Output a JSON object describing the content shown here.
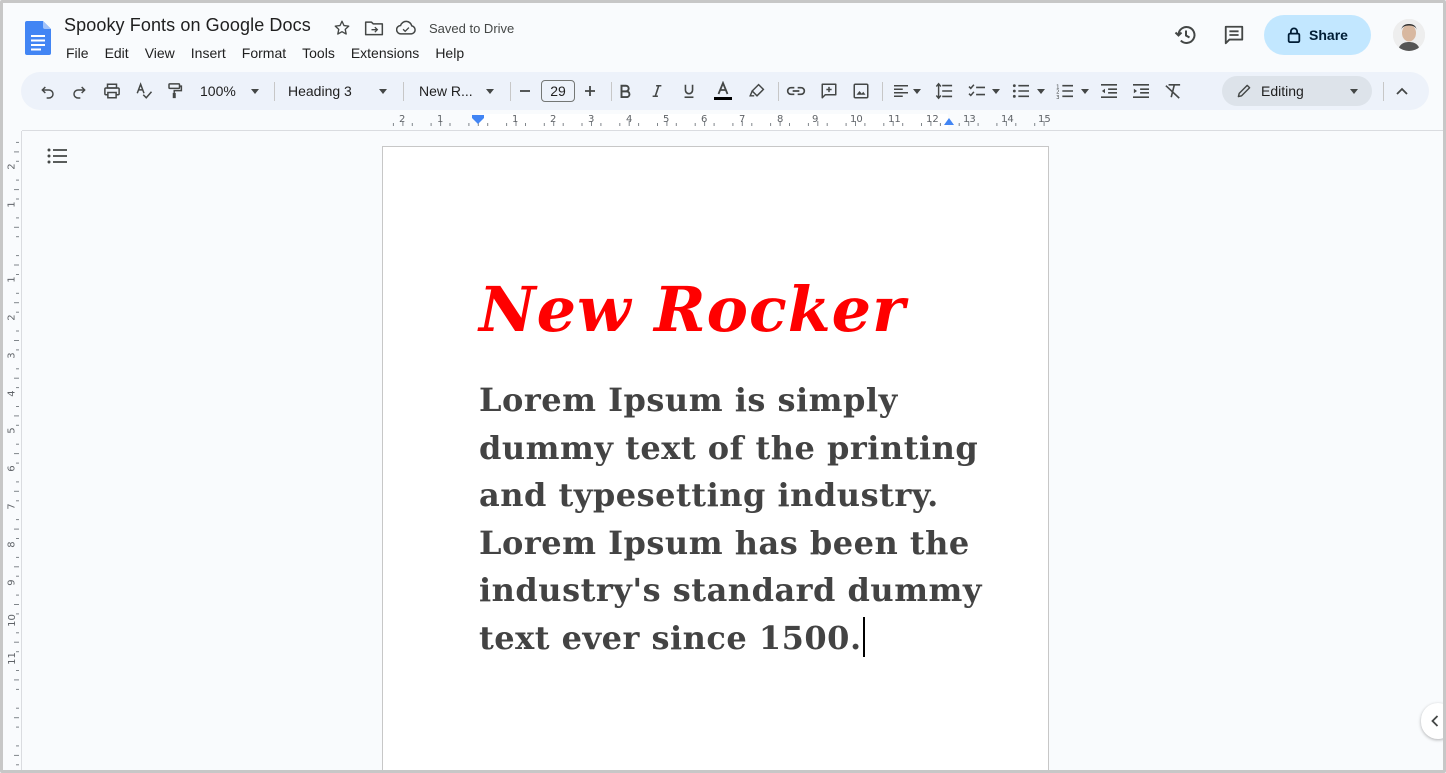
{
  "document": {
    "title": "Spooky Fonts on Google Docs",
    "saved_status": "Saved to Drive"
  },
  "menu": [
    "File",
    "Edit",
    "View",
    "Insert",
    "Format",
    "Tools",
    "Extensions",
    "Help"
  ],
  "header_actions": {
    "share_label": "Share"
  },
  "toolbar": {
    "zoom": "100%",
    "style": "Heading 3",
    "font": "New R...",
    "font_size": "29",
    "mode": "Editing"
  },
  "ruler": {
    "horizontal_labels": [
      "2",
      "1",
      "1",
      "2",
      "3",
      "4",
      "5",
      "6",
      "7",
      "8",
      "9",
      "10",
      "11",
      "12",
      "13",
      "14",
      "15"
    ],
    "vertical_labels": [
      "2",
      "1",
      "1",
      "2",
      "3",
      "4",
      "5",
      "6",
      "7",
      "8",
      "9",
      "10",
      "11"
    ]
  },
  "page": {
    "heading": "New Rocker",
    "body_lines": [
      "Lorem Ipsum is simply",
      "dummy text of the printing",
      "and typesetting industry.",
      "Lorem Ipsum has been the",
      "industry's standard dummy",
      "text ever since 1500."
    ]
  },
  "colors": {
    "heading": "#ff0000",
    "body": "#434343",
    "share_bg": "#c2e7ff",
    "toolbar_bg": "#edf2fa",
    "docs_blue": "#4285f4"
  }
}
